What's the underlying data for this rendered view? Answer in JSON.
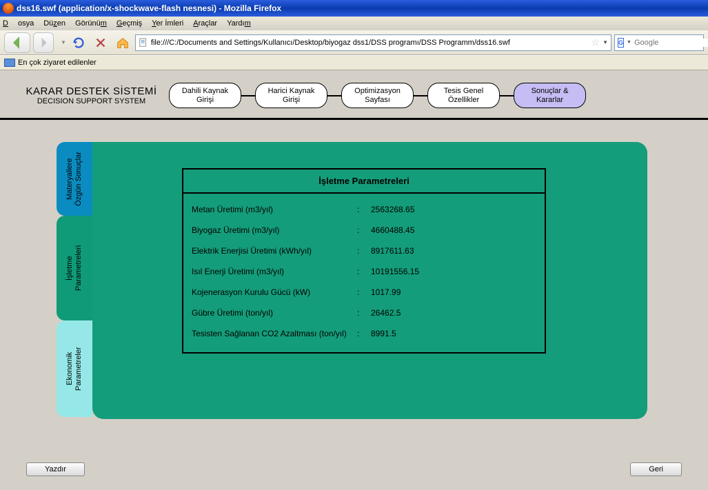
{
  "window": {
    "title": "dss16.swf (application/x-shockwave-flash nesnesi) - Mozilla Firefox"
  },
  "menu": {
    "dosya": "Dosya",
    "duzen": "Düzen",
    "gorunum": "Görünüm",
    "gecmis": "Geçmiş",
    "yerimleri": "Yer İmleri",
    "araclar": "Araçlar",
    "yardim": "Yardım"
  },
  "url": "file:///C:/Documents and Settings/Kullanıcı/Desktop/biyogaz dss1/DSS programı/DSS Programm/dss16.swf",
  "search": {
    "placeholder": "Google"
  },
  "bookmark": {
    "label": "En çok ziyaret edilenler"
  },
  "app": {
    "title1": "KARAR DESTEK SİSTEMİ",
    "title2": "DECISION SUPPORT SYSTEM",
    "pills": [
      "Dahili Kaynak\nGirişi",
      "Harici Kaynak\nGirişi",
      "Optimizasyon\nSayfası",
      "Tesis Genel\nÖzellikler",
      "Sonuçlar &\nKararlar"
    ]
  },
  "tabs": {
    "t1": "Materyallere\nÖzgün Sonuçlar",
    "t2": "İşletme\nParametreleri",
    "t3": "Ekonomik\nParametreler"
  },
  "panel": {
    "title": "İşletme Parametreleri",
    "rows": [
      {
        "label": "Metan Üretimi (m3/yıl)",
        "value": "2563268.65"
      },
      {
        "label": "Biyogaz Üretimi (m3/yıl)",
        "value": "4660488.45"
      },
      {
        "label": "Elektrik Enerjisi Üretimi (kWh/yıl)",
        "value": "8917611.63"
      },
      {
        "label": "Isıl Enerji Üretimi (m3/yıl)",
        "value": "10191556.15"
      },
      {
        "label": "Kojenerasyon Kurulu Gücü (kW)",
        "value": "1017.99"
      },
      {
        "label": "Gübre Üretimi (ton/yıl)",
        "value": "26462.5"
      },
      {
        "label": "Tesisten Sağlanan CO2 Azaltması (ton/yıl)",
        "value": "8991.5"
      }
    ]
  },
  "buttons": {
    "print": "Yazdır",
    "back": "Geri"
  }
}
